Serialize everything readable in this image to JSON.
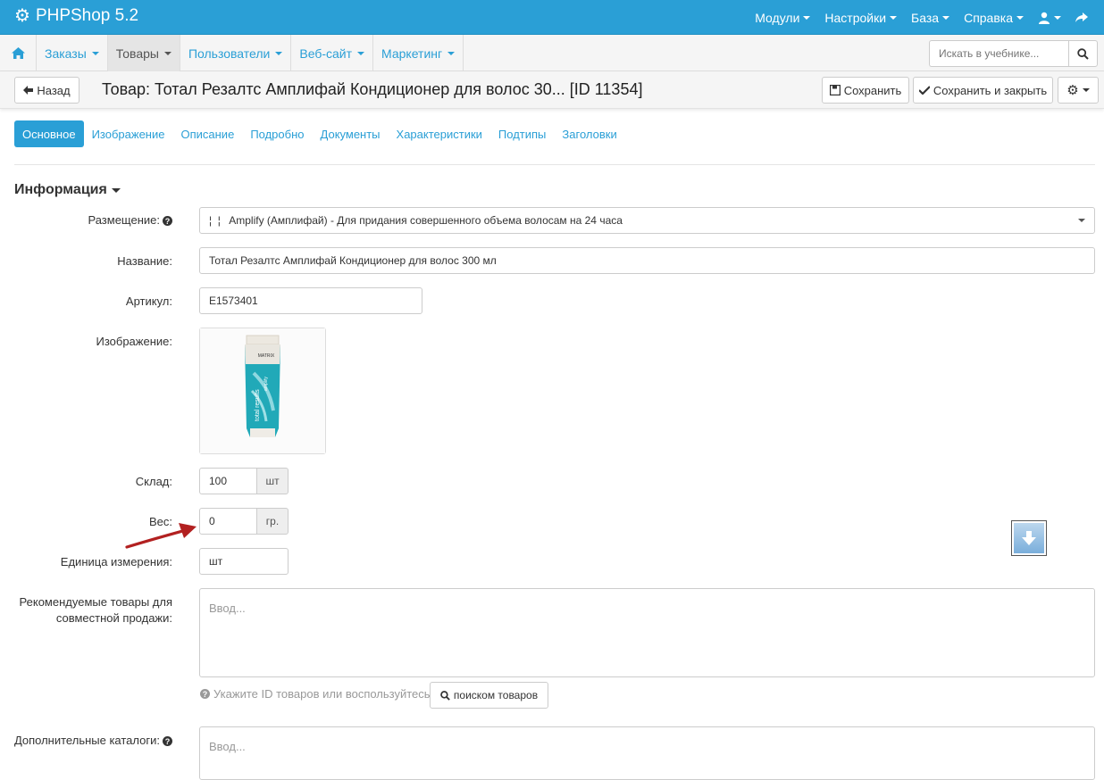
{
  "navbar": {
    "brand": "PHPShop 5.2",
    "menu": [
      {
        "label": "Модули"
      },
      {
        "label": "Настройки"
      },
      {
        "label": "База"
      },
      {
        "label": "Справка"
      }
    ]
  },
  "subnav": {
    "tabs": [
      {
        "label": "Заказы"
      },
      {
        "label": "Товары"
      },
      {
        "label": "Пользователи"
      },
      {
        "label": "Веб-сайт"
      },
      {
        "label": "Маркетинг"
      }
    ],
    "search_placeholder": "Искать в учебнике..."
  },
  "header": {
    "back_label": "Назад",
    "title": "Товар: Тотал Резалтс Амплифай Кондиционер для волос 30... [ID 11354]",
    "save_label": "Сохранить",
    "save_close_label": "Сохранить и закрыть"
  },
  "content_tabs": [
    "Основное",
    "Изображение",
    "Описание",
    "Подробно",
    "Документы",
    "Характеристики",
    "Подтипы",
    "Заголовки"
  ],
  "section_title": "Информация",
  "form": {
    "placement_label": "Размещение:",
    "placement_value": "¦  ¦   Amplify (Амплифай) - Для придания совершенного объема волосам на 24 часа",
    "name_label": "Название:",
    "name_value": "Тотал Резалтс Амплифай Кондиционер для волос 300 мл",
    "sku_label": "Артикул:",
    "sku_value": "E1573401",
    "image_label": "Изображение:",
    "stock_label": "Склад:",
    "stock_value": "100",
    "stock_unit": "шт",
    "weight_label": "Вес:",
    "weight_value": "0",
    "weight_unit": "гр.",
    "unit_label": "Единица измерения:",
    "unit_value": "шт",
    "recommended_label_1": "Рекомендуемые товары для",
    "recommended_label_2": "совместной продажи:",
    "recommended_placeholder": "Ввод...",
    "hint_text": "Укажите ID товаров или воспользуйтесь",
    "search_products_label": "поиском товаров",
    "extra_catalogs_label": "Дополнительные каталоги:",
    "extra_catalogs_placeholder": "Ввод..."
  },
  "product_image": {
    "brand_text": "MATRIX",
    "line_text": "total results",
    "sub_text": "amplify"
  },
  "colors": {
    "accent": "#2a9fd6",
    "arrow": "#b22020"
  }
}
